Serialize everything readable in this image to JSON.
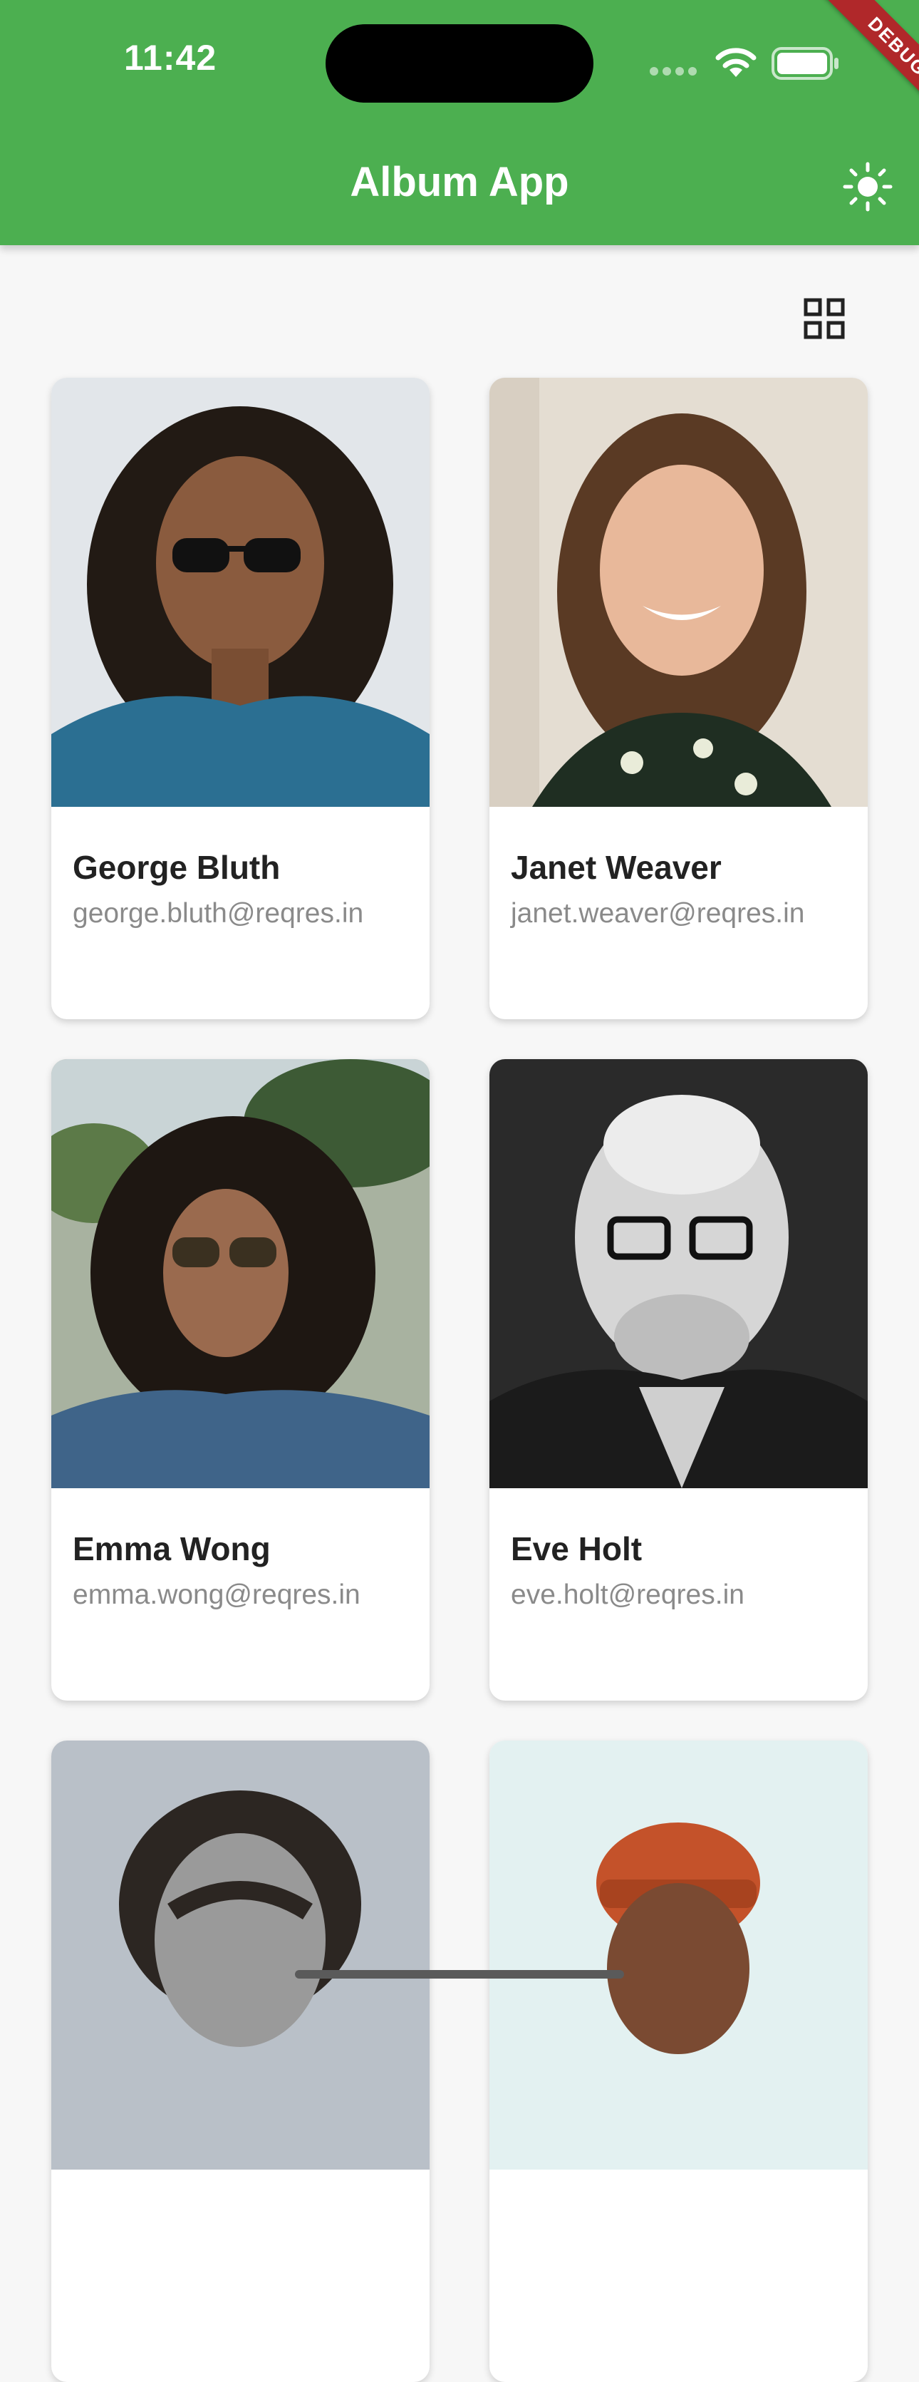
{
  "status_bar": {
    "time": "11:42"
  },
  "debug_banner": "DEBUG",
  "app_bar": {
    "title": "Album App",
    "theme_icon": "sun-icon",
    "accent": "#4caf50"
  },
  "toolbar": {
    "layout_icon": "grid-view-icon"
  },
  "users": [
    {
      "name": "George Bluth",
      "email": "george.bluth@reqres.in"
    },
    {
      "name": "Janet Weaver",
      "email": "janet.weaver@reqres.in"
    },
    {
      "name": "Emma Wong",
      "email": "emma.wong@reqres.in"
    },
    {
      "name": "Eve Holt",
      "email": "eve.holt@reqres.in"
    },
    {
      "name": "",
      "email": ""
    },
    {
      "name": "",
      "email": ""
    }
  ]
}
